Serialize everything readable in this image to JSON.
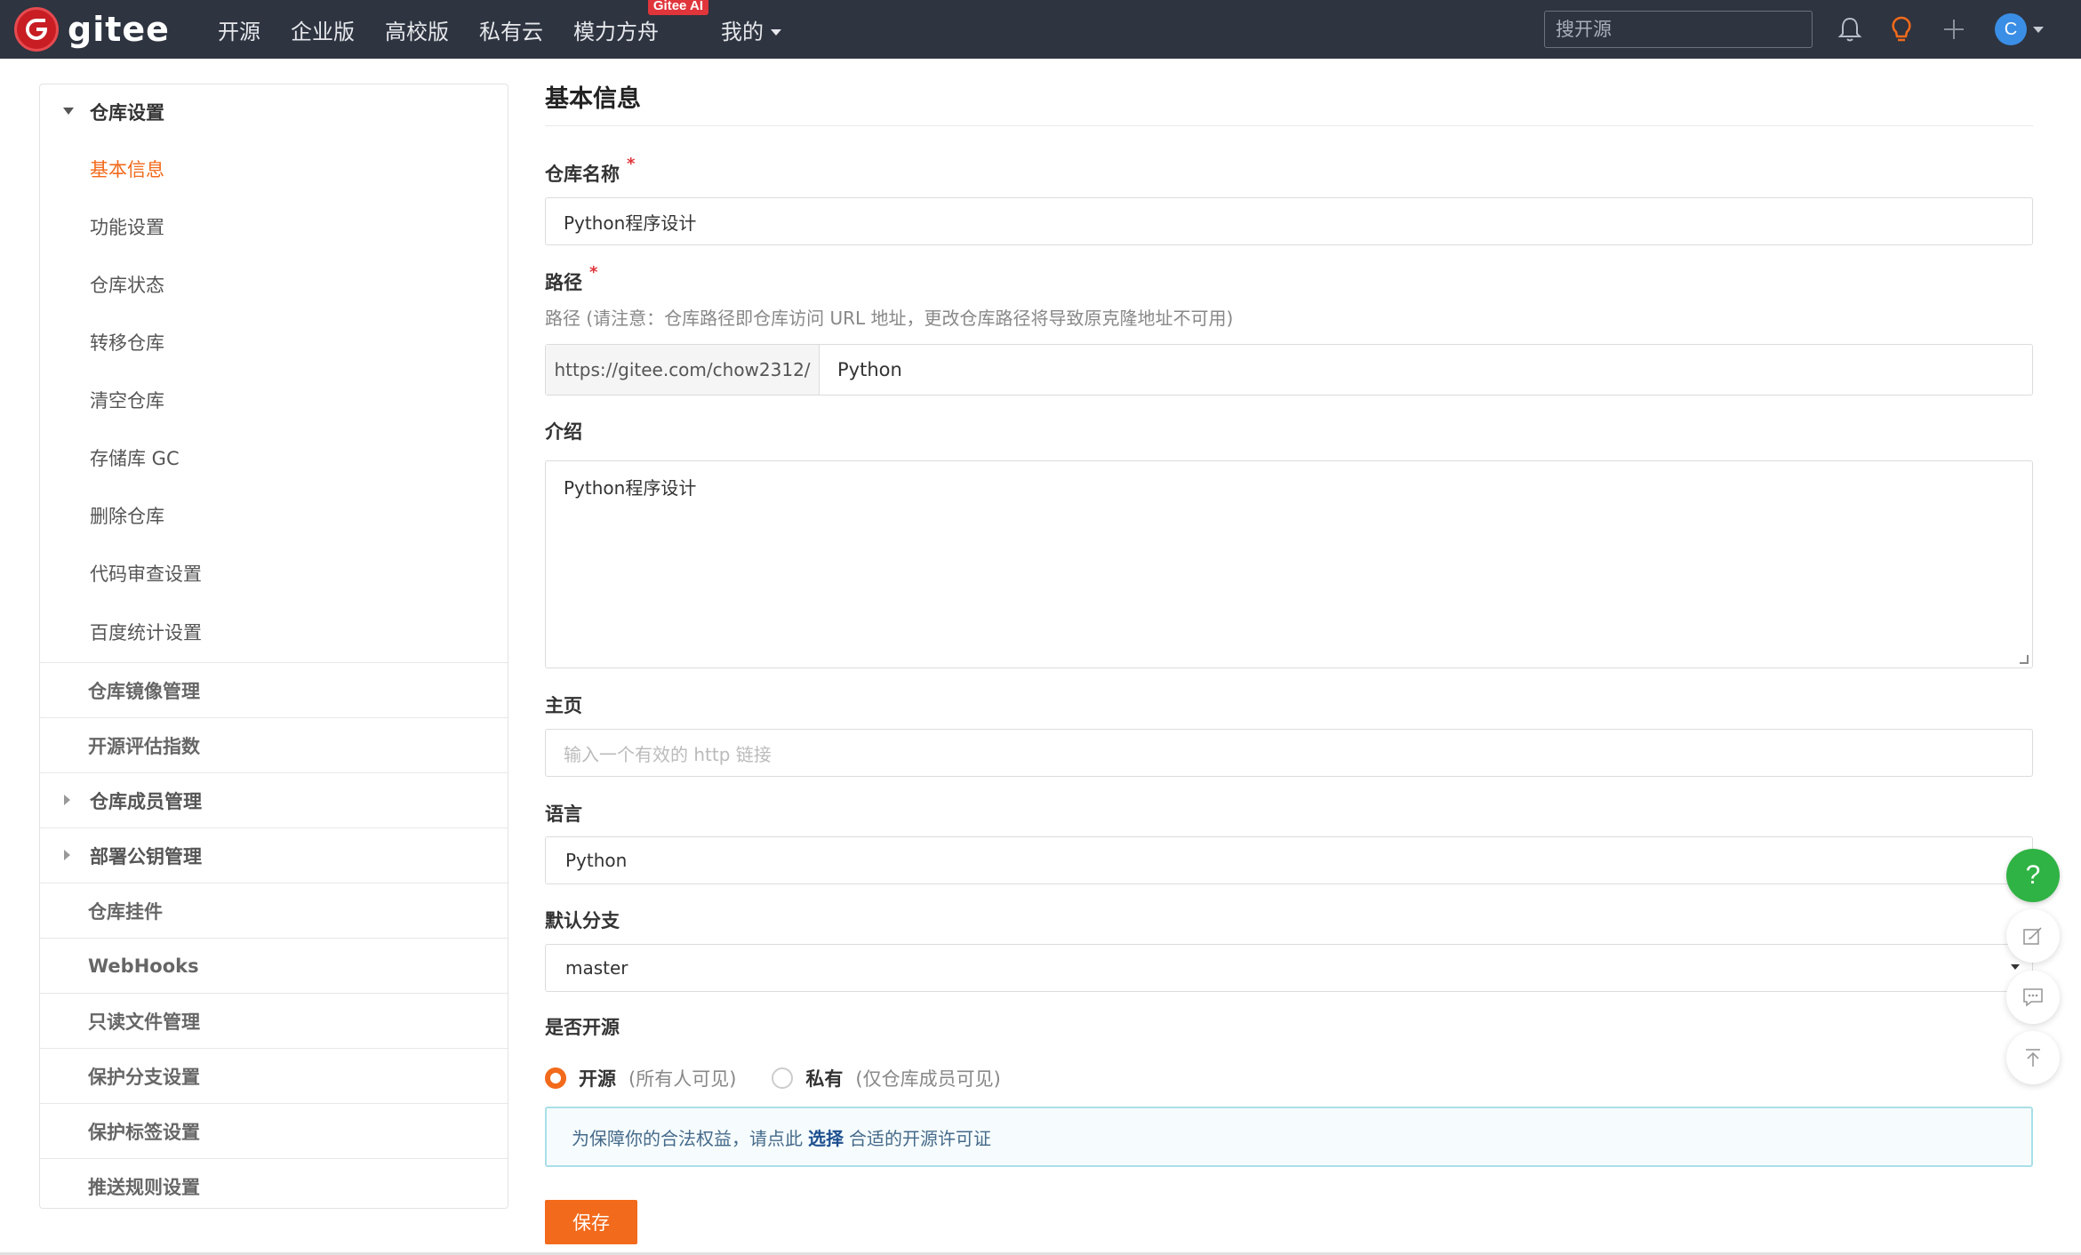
{
  "brand": {
    "name": "gitee",
    "color": "#c71d23"
  },
  "nav": {
    "items": [
      "开源",
      "企业版",
      "高校版",
      "私有云",
      "模力方舟"
    ],
    "badge": "Gitee AI",
    "mine": "我的"
  },
  "search": {
    "placeholder": "搜开源"
  },
  "avatar": {
    "initial": "C"
  },
  "sidebar": {
    "group": "仓库设置",
    "subs": [
      "基本信息",
      "功能设置",
      "仓库状态",
      "转移仓库",
      "清空仓库",
      "存储库 GC",
      "删除仓库",
      "代码审查设置",
      "百度统计设置"
    ],
    "active": "基本信息",
    "items": [
      "仓库镜像管理",
      "开源评估指数",
      "仓库成员管理",
      "部署公钥管理",
      "仓库挂件",
      "WebHooks",
      "只读文件管理",
      "保护分支设置",
      "保护标签设置",
      "推送规则设置"
    ]
  },
  "form": {
    "title": "基本信息",
    "name_label": "仓库名称",
    "name_value": "Python程序设计",
    "required_mark": "*",
    "path_label": "路径",
    "path_hint": "路径 (请注意：仓库路径即仓库访问 URL 地址，更改仓库路径将导致原克隆地址不可用)",
    "path_prefix": "https://gitee.com/chow2312/",
    "path_value": "Python",
    "intro_label": "介绍",
    "intro_value": "Python程序设计",
    "homepage_label": "主页",
    "homepage_placeholder": "输入一个有效的 http 链接",
    "language_label": "语言",
    "language_value": "Python",
    "branch_label": "默认分支",
    "branch_value": "master",
    "open_label": "是否开源",
    "radio_public": "开源",
    "radio_public_desc": "(所有人可见)",
    "radio_private": "私有",
    "radio_private_desc": "(仅仓库成员可见)",
    "notice_before": "为保障你的合法权益，请点此",
    "notice_link": "选择",
    "notice_after": "合适的开源许可证",
    "save": "保存"
  },
  "float": {
    "help": "?"
  },
  "colors": {
    "accent": "#f26a1b",
    "topbar": "#2e3440",
    "help": "#2fb344"
  }
}
